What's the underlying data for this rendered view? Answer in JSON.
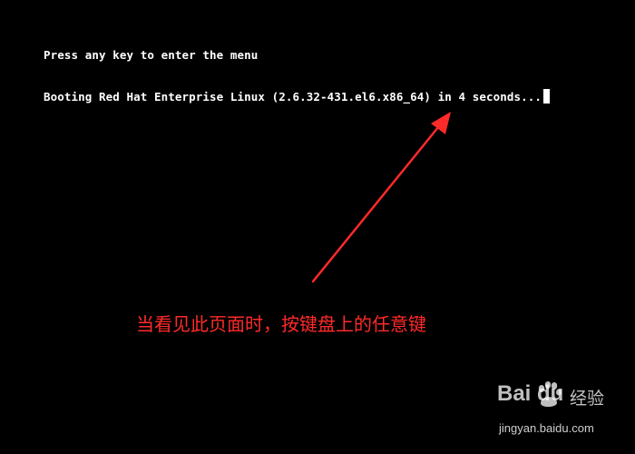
{
  "console": {
    "line1": "Press any key to enter the menu",
    "line2": "Booting Red Hat Enterprise Linux (2.6.32-431.el6.x86_64) in 4 seconds..."
  },
  "annotation": {
    "text": "当看见此页面时，按键盘上的任意键",
    "color": "#ff2a2a"
  },
  "watermark": {
    "logo_text": "Bai du",
    "product_text": "经验",
    "url": "jingyan.baidu.com"
  },
  "colors": {
    "background": "#000000",
    "console_text": "#ffffff",
    "arrow": "#ff2a2a"
  }
}
